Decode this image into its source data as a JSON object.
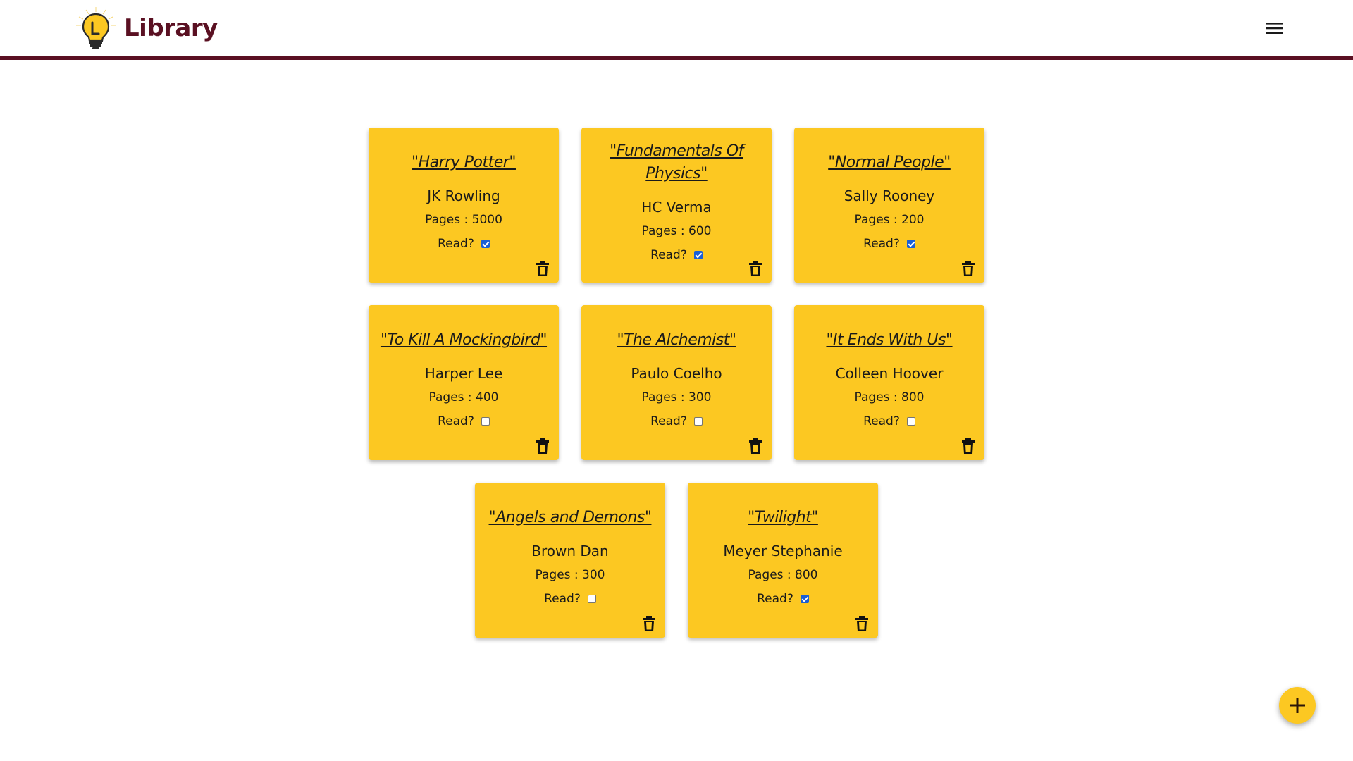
{
  "header": {
    "title": "Library",
    "logo_icon": "lightbulb-icon",
    "menu_icon": "hamburger-menu-icon",
    "brand_color": "#5a1022",
    "accent_color": "#fcc822"
  },
  "read_label": "Read?",
  "books": [
    {
      "title": "\"Harry Potter\"",
      "author": "JK Rowling",
      "pages": "Pages : 5000",
      "read": true
    },
    {
      "title": "\"Fundamentals Of Physics\"",
      "author": "HC Verma",
      "pages": "Pages : 600",
      "read": true
    },
    {
      "title": "\"Normal People\"",
      "author": "Sally Rooney",
      "pages": "Pages : 200",
      "read": true
    },
    {
      "title": "\"To Kill A Mockingbird\"",
      "author": "Harper Lee",
      "pages": "Pages : 400",
      "read": false
    },
    {
      "title": "\"The Alchemist\"",
      "author": "Paulo Coelho",
      "pages": "Pages : 300",
      "read": false
    },
    {
      "title": "\"It Ends With Us\"",
      "author": "Colleen Hoover",
      "pages": "Pages : 800",
      "read": false
    },
    {
      "title": "\"Angels and Demons\"",
      "author": "Brown Dan",
      "pages": "Pages : 300",
      "read": false
    },
    {
      "title": "\"Twilight\"",
      "author": "Meyer Stephanie",
      "pages": "Pages : 800",
      "read": true
    }
  ],
  "fab": {
    "icon": "plus-icon"
  }
}
